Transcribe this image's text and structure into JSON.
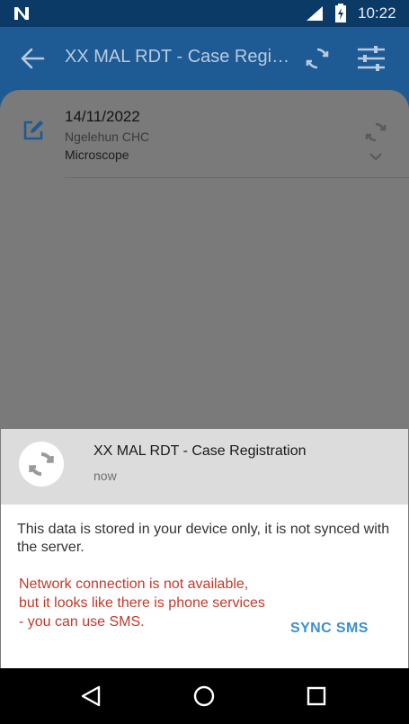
{
  "status_bar": {
    "time": "10:22"
  },
  "app_bar": {
    "title": "XX MAL RDT - Case Registration"
  },
  "event": {
    "date": "14/11/2022",
    "org_unit": "Ngelehun CHC",
    "program_stage": "Microscope"
  },
  "sheet": {
    "title": "XX MAL RDT - Case Registration",
    "subtitle": "now",
    "info": "This data is stored in your device only, it is not synced with the server.",
    "warning": "Network connection is not available, but it looks like there is phone services - you can use SMS.",
    "sync_sms_label": "SYNC SMS"
  },
  "colors": {
    "status_bar": "#0b3a66",
    "app_bar": "#1e5a94",
    "warning": "#c0392b",
    "accent": "#3b8fd1"
  }
}
